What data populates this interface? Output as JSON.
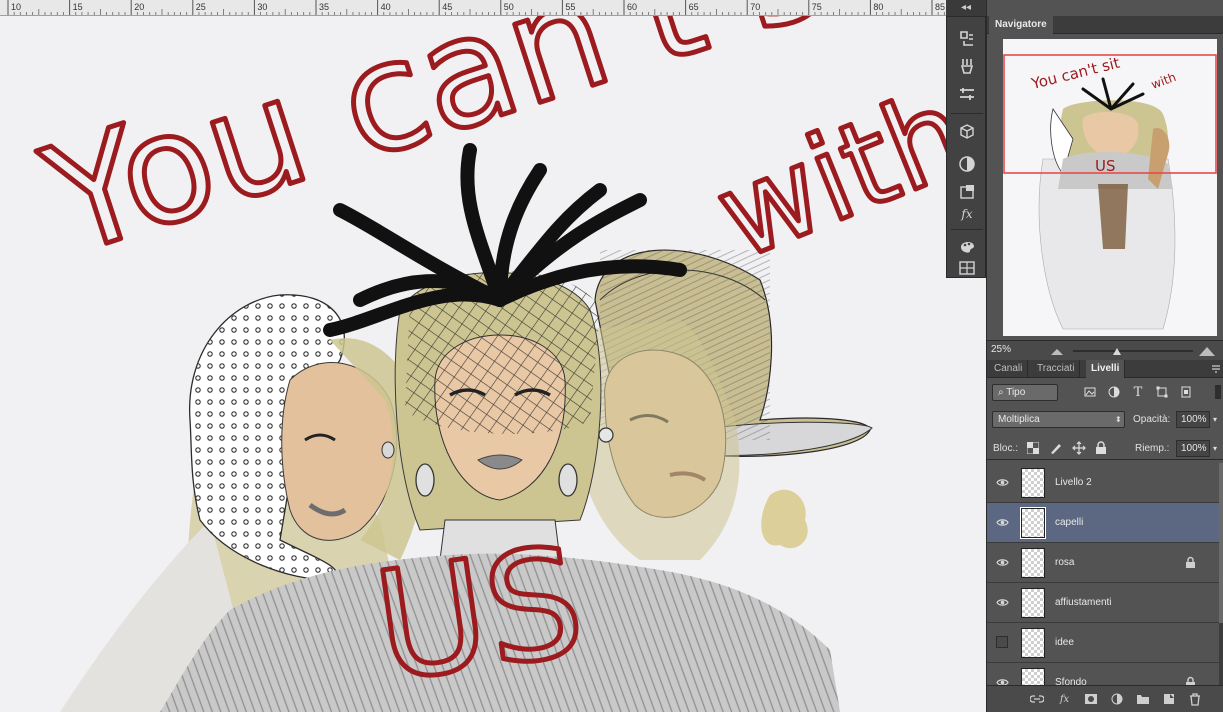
{
  "ruler": {
    "ticks": [
      "10",
      "15",
      "20",
      "25",
      "30",
      "35",
      "40",
      "45",
      "50",
      "55",
      "60",
      "65",
      "70",
      "75",
      "80",
      "85"
    ]
  },
  "artwork": {
    "text_line1": "You can't sit",
    "text_line2": "with",
    "text_line3": "US"
  },
  "collapse_strip": {
    "label": "◂◂"
  },
  "tool_strip": {
    "tools": [
      "history-icon",
      "brush-presets-icon",
      "tool-presets-icon",
      "3d-icon",
      "adjustments-icon",
      "properties-icon",
      "styles-icon",
      "swatches-icon",
      "grid-icon"
    ]
  },
  "navigator": {
    "title": "Navigatore",
    "zoom": "25%",
    "thumb_text1": "You can't sit",
    "thumb_text2": "with",
    "thumb_text3": "US"
  },
  "layers_panel": {
    "tabs": [
      "Canali",
      "Tracciati",
      "Livelli"
    ],
    "filter_kind": "Tipo",
    "blend_mode": "Moltiplica",
    "opacity_label": "Opacità:",
    "opacity_value": "100%",
    "lock_label": "Bloc.:",
    "fill_label": "Riemp.:",
    "fill_value": "100%",
    "layers": [
      {
        "name": "Livello 2",
        "visible": true,
        "selected": false,
        "locked": false
      },
      {
        "name": "capelli",
        "visible": true,
        "selected": true,
        "locked": false
      },
      {
        "name": "rosa",
        "visible": true,
        "selected": false,
        "locked": true
      },
      {
        "name": "affiustamenti",
        "visible": true,
        "selected": false,
        "locked": false
      },
      {
        "name": "idee",
        "visible": false,
        "selected": false,
        "locked": false
      },
      {
        "name": "Sfondo",
        "visible": true,
        "selected": false,
        "locked": true
      }
    ]
  },
  "colors": {
    "text_red": "#9b1b1e",
    "hair": "#cdc591",
    "skin": "#e9c8a6",
    "selected_row": "#5c6782"
  }
}
